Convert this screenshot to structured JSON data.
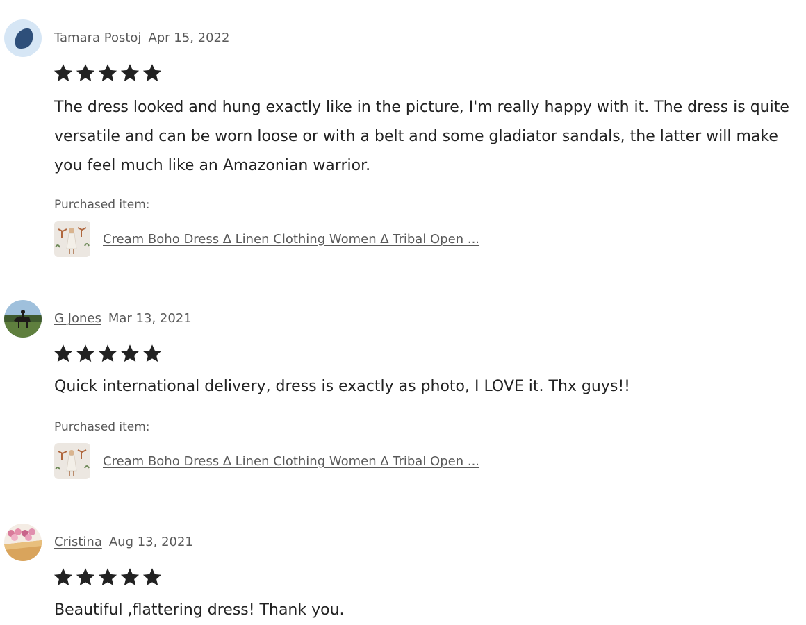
{
  "reviews": [
    {
      "reviewer": "Tamara Postoj",
      "date": "Apr 15, 2022",
      "rating": 5,
      "text": "The dress looked and hung exactly like in the picture, I'm really happy with it. The dress is quite versatile and can be worn loose or with a belt and some gladiator sandals, the latter will make you feel much like an Amazonian warrior.",
      "purchased_label": "Purchased item:",
      "item_title": "Cream Boho Dress ∆ Linen Clothing Women ∆ Tribal Open ..."
    },
    {
      "reviewer": "G Jones",
      "date": "Mar 13, 2021",
      "rating": 5,
      "text": "Quick international delivery, dress is exactly as photo, I LOVE it. Thx guys!!",
      "purchased_label": "Purchased item:",
      "item_title": "Cream Boho Dress ∆ Linen Clothing Women ∆ Tribal Open ..."
    },
    {
      "reviewer": "Cristina",
      "date": "Aug 13, 2021",
      "rating": 5,
      "text": "Beautiful ,flattering dress! Thank you."
    }
  ],
  "colors": {
    "star": "#222222",
    "muted_text": "#595959",
    "body_text": "#222222"
  },
  "icons": {
    "star": "star-icon"
  }
}
